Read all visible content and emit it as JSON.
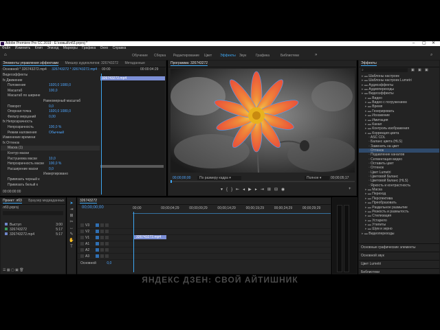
{
  "window": {
    "title": "Adobe Premiere Pro CC 2019 - Е:\\новый\\лб3.prproj *",
    "controls": [
      "–",
      "▢",
      "✕"
    ]
  },
  "menu": [
    "Файл",
    "Изменить",
    "Клип",
    "Эпизод",
    "Маркеры",
    "Графика",
    "Окно",
    "Справка"
  ],
  "workspaces": {
    "items": [
      "Обучение",
      "Сборка",
      "Редактирование",
      "Цвет",
      "Эффекты",
      "Звук",
      "Графика",
      "Библиотеки"
    ],
    "active": 4
  },
  "effect_controls": {
    "tabs": [
      "Элементы управления эффектами",
      "Микшер аудиоклипов: 326743272",
      "Метаданные"
    ],
    "source": "Основной * 326743272.mp4",
    "sequence": "326743272 * 326743272.mp4",
    "timecodes": [
      "00:00",
      "00:00:04:29"
    ],
    "clip_label": "326743272.mp4",
    "rows": [
      {
        "label": "Видеоэффекты",
        "value": ""
      },
      {
        "label": "fx  Движение",
        "value": ""
      },
      {
        "label": "Положение",
        "value": "1920,0   1080,0"
      },
      {
        "label": "Масштаб",
        "value": "100,0"
      },
      {
        "label": "Масштаб по ширине",
        "value": ""
      },
      {
        "label": "",
        "value": "Равномерный масштаб"
      },
      {
        "label": "Поворот",
        "value": "0,0"
      },
      {
        "label": "Опорная точка",
        "value": "1920,0   1080,0"
      },
      {
        "label": "Фильтр мерцаний",
        "value": "0,00"
      },
      {
        "label": "fx  Непрозрачность",
        "value": ""
      },
      {
        "label": "Непрозрачность",
        "value": "100,0 %"
      },
      {
        "label": "Режим наложения",
        "value": "Обычный"
      },
      {
        "label": "Изменение времени",
        "value": ""
      },
      {
        "label": "fx  Оттенок",
        "value": ""
      },
      {
        "label": "Маска (1)",
        "value": ""
      },
      {
        "label": "Контур маски",
        "value": ""
      },
      {
        "label": "Растушевка маски",
        "value": "10,0"
      },
      {
        "label": "Непрозрачность маски",
        "value": "100,0 %"
      },
      {
        "label": "Расширение маски",
        "value": "0,0"
      },
      {
        "label": "",
        "value": "Инвертировано"
      },
      {
        "label": "Привязать черный к",
        "value": ""
      },
      {
        "label": "Привязать белый к",
        "value": ""
      }
    ],
    "current_time": "00:00:00:00"
  },
  "program": {
    "tab": "Программа: 326743272",
    "timecode_left": "00;00;00;00",
    "fit": "По размеру кадра",
    "quality": "Полное",
    "timecode_right": "00;00;05;17"
  },
  "effects_panel": {
    "title": "Эффекты",
    "items": [
      {
        "label": "Шаблоны настроек",
        "level": 1
      },
      {
        "label": "Шаблоны настроек Lumetri",
        "level": 1
      },
      {
        "label": "Аудиоэффекты",
        "level": 1
      },
      {
        "label": "Аудиопереходы",
        "level": 1
      },
      {
        "label": "Видеоэффекты",
        "level": 1
      },
      {
        "label": "Видео",
        "level": 2
      },
      {
        "label": "Видео с погружением",
        "level": 2
      },
      {
        "label": "Время",
        "level": 2
      },
      {
        "label": "Генерировать",
        "level": 2
      },
      {
        "label": "Искажение",
        "level": 2
      },
      {
        "label": "Имитация",
        "level": 2
      },
      {
        "label": "Канал",
        "level": 2
      },
      {
        "label": "Контроль изображения",
        "level": 2
      },
      {
        "label": "Коррекция цвета",
        "level": 2
      },
      {
        "label": "ASC CDL",
        "level": 3
      },
      {
        "label": "Баланс цвета (HLS)",
        "level": 3
      },
      {
        "label": "Заменить на цвет",
        "level": 3
      },
      {
        "label": "Оттенок",
        "level": 3
      },
      {
        "label": "Подавление каналов",
        "level": 3
      },
      {
        "label": "Сегментация видео",
        "level": 3
      },
      {
        "label": "Оставить цвет",
        "level": 3
      },
      {
        "label": "Оттенок",
        "level": 3
      },
      {
        "label": "Цвет Lumetri",
        "level": 3
      },
      {
        "label": "Цветовой баланс",
        "level": 3
      },
      {
        "label": "Цветовой баланс (HLS)",
        "level": 3
      },
      {
        "label": "Яркость и контрастность",
        "level": 3
      },
      {
        "label": "Маска",
        "level": 2
      },
      {
        "label": "Переход",
        "level": 2
      },
      {
        "label": "Перспектива",
        "level": 2
      },
      {
        "label": "Преобразовать",
        "level": 2
      },
      {
        "label": "Раздельное размытие",
        "level": 2
      },
      {
        "label": "Резкость и размытость",
        "level": 2
      },
      {
        "label": "Стилизация",
        "level": 2
      },
      {
        "label": "Устарело",
        "level": 2
      },
      {
        "label": "Утилиты",
        "level": 2
      },
      {
        "label": "Шум и зерно",
        "level": 2
      },
      {
        "label": "Видеопереходы",
        "level": 1
      }
    ],
    "highlight_index": 17,
    "bottom_panels": [
      "Основные графические элементы",
      "Основной звук",
      "Цвет Lumetri",
      "Библиотеки"
    ]
  },
  "project": {
    "tabs": [
      "Проект: лб3",
      "Браузер медиаданных"
    ],
    "file": "лб3.prproj",
    "items": [
      {
        "name": "Выступ",
        "meta": "3:00"
      },
      {
        "name": "326743272",
        "meta": "5:17"
      },
      {
        "name": "326743272.mp4",
        "meta": "5:17"
      }
    ]
  },
  "timeline": {
    "tab": "326743272",
    "timecode": "00;00;00;00",
    "ruler": [
      "00;00",
      "00;00;04;29",
      "00;00;09;29",
      "00;00;14;29",
      "00;00;19;29",
      "00;00;24;29",
      "00;00;29;29"
    ],
    "tracks": [
      "V3",
      "V2",
      "V1",
      "A1",
      "A2",
      "A3"
    ],
    "master": "Основной",
    "master_value": "0,0",
    "clip": "326743272.mp4"
  },
  "watermark": "ЯНДЕКС ДЗЕН: СВОЙ АЙТИШНИК",
  "colors": {
    "accent": "#3fa9f5",
    "panel": "#232323",
    "clip": "#7c8fd6",
    "highlight": "#2f4a6b"
  }
}
